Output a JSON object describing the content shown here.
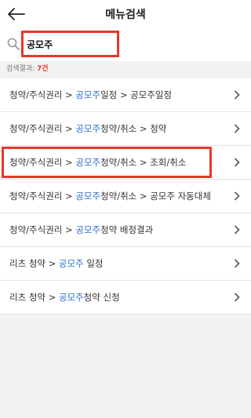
{
  "header": {
    "title": "메뉴검색",
    "back_icon": "arrow-left-icon"
  },
  "search": {
    "value": "공모주",
    "icon": "search-icon"
  },
  "results": {
    "label": "검색결과:",
    "count": "7건"
  },
  "items": [
    {
      "pre": "청약/주식권리 > ",
      "hl": "공모주",
      "post": "일정 > 공모주일정"
    },
    {
      "pre": "청약/주식권리 > ",
      "hl": "공모주",
      "post": "청약/취소 > 청약"
    },
    {
      "pre": "청약/주식권리 > ",
      "hl": "공모주",
      "post": "청약/취소 > 조회/취소"
    },
    {
      "pre": "청약/주식권리 > ",
      "hl": "공모주",
      "post": "청약/취소 > 공모주 자동대체"
    },
    {
      "pre": "청약/주식권리 > ",
      "hl": "공모주",
      "post": "청약 배정결과"
    },
    {
      "pre": "리츠 청약 > ",
      "hl": "공모주",
      "post": " 일정"
    },
    {
      "pre": "리츠 청약 > ",
      "hl": "공모주",
      "post": "청약 신청"
    }
  ],
  "colors": {
    "highlight_text": "#2a6fc9",
    "annotation_red": "#e8372a",
    "background": "#f2f2f2"
  }
}
